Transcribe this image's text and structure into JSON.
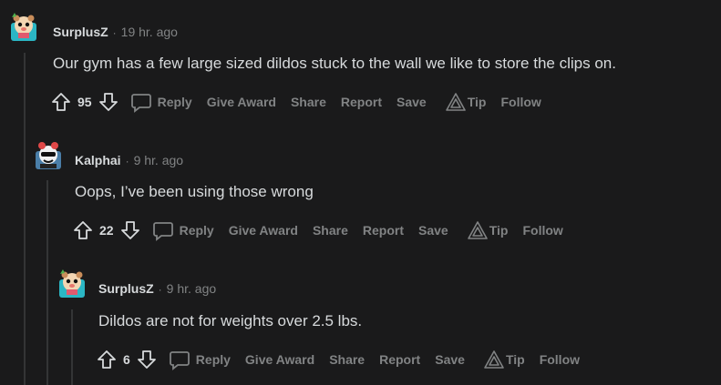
{
  "comments": [
    {
      "author": "SurplusZ",
      "separator": "·",
      "time": "19 hr. ago",
      "body": "Our gym has a few large sized dildos stuck to the wall we like to store the clips on.",
      "score": "95",
      "actions": {
        "reply": "Reply",
        "award": "Give Award",
        "share": "Share",
        "report": "Report",
        "save": "Save",
        "tip": "Tip",
        "follow": "Follow"
      }
    },
    {
      "author": "Kalphai",
      "separator": "·",
      "time": "9 hr. ago",
      "body": "Oops, I’ve been using those wrong",
      "score": "22",
      "actions": {
        "reply": "Reply",
        "award": "Give Award",
        "share": "Share",
        "report": "Report",
        "save": "Save",
        "tip": "Tip",
        "follow": "Follow"
      }
    },
    {
      "author": "SurplusZ",
      "separator": "·",
      "time": "9 hr. ago",
      "body": "Dildos are not for weights over 2.5 lbs.",
      "score": "6",
      "actions": {
        "reply": "Reply",
        "award": "Give Award",
        "share": "Share",
        "report": "Report",
        "save": "Save",
        "tip": "Tip",
        "follow": "Follow"
      }
    }
  ],
  "colors": {
    "background": "#1a1a1b",
    "text": "#d7dadc",
    "muted": "#818384",
    "thread": "#343536"
  },
  "icons": [
    "upvote-icon",
    "downvote-icon",
    "comment-bubble-icon",
    "tip-triangle-icon",
    "avatar"
  ]
}
